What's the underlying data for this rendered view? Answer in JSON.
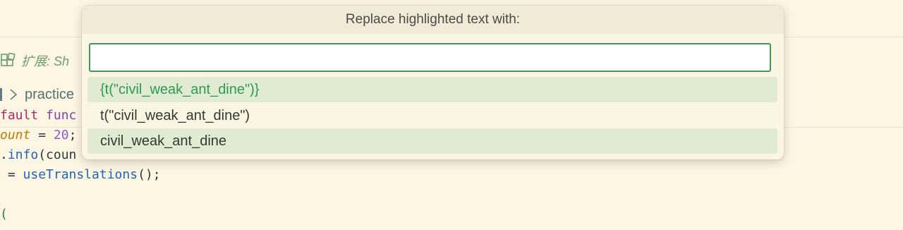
{
  "editor": {
    "extension_label": "扩展: Sh",
    "breadcrumb": "practice",
    "code_lines": [
      {
        "tokens": [
          {
            "cls": "tok-kw",
            "text": "fault "
          },
          {
            "cls": "tok-purple",
            "text": "func"
          }
        ]
      },
      {
        "tokens": [
          {
            "cls": "tok-var",
            "text": "ount"
          },
          {
            "cls": "tok-plain",
            "text": " = "
          },
          {
            "cls": "tok-num",
            "text": "20"
          },
          {
            "cls": "tok-plain",
            "text": ";"
          }
        ]
      },
      {
        "tokens": [
          {
            "cls": "tok-plain",
            "text": "."
          },
          {
            "cls": "tok-fn",
            "text": "info"
          },
          {
            "cls": "tok-plain",
            "text": "(coun"
          }
        ]
      },
      {
        "tokens": [
          {
            "cls": "tok-plain",
            "text": " = "
          },
          {
            "cls": "tok-fn",
            "text": "useTranslations"
          },
          {
            "cls": "tok-plain",
            "text": "();"
          }
        ]
      },
      {
        "tokens": [
          {
            "cls": "tok-paren",
            "text": "("
          }
        ]
      }
    ]
  },
  "palette": {
    "title": "Replace highlighted text with:",
    "input_value": "",
    "options": [
      {
        "label": "{t(\"civil_weak_ant_dine\")}",
        "highlighted": true,
        "active": true
      },
      {
        "label": "t(\"civil_weak_ant_dine\")",
        "highlighted": false,
        "active": false
      },
      {
        "label": "civil_weak_ant_dine",
        "highlighted": true,
        "active": false
      }
    ]
  },
  "colors": {
    "accent_green": "#2f9a52",
    "editor_bg": "#fdf6e3"
  }
}
